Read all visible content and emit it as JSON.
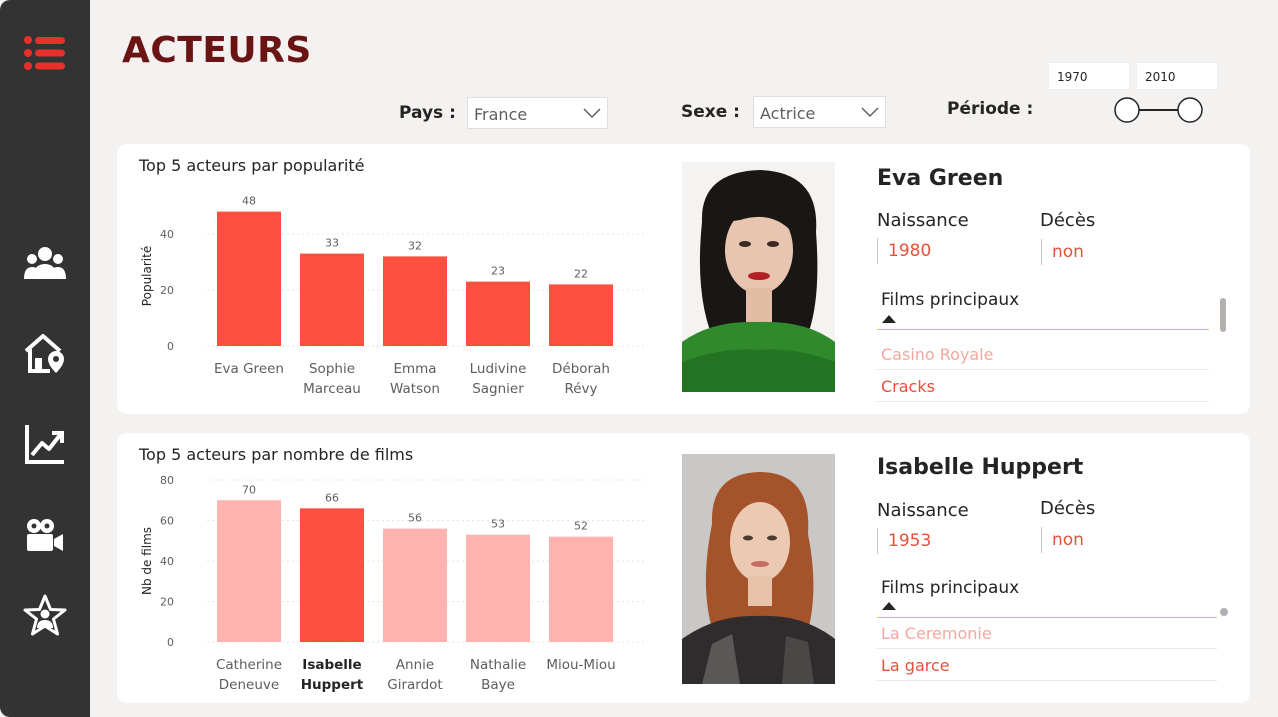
{
  "page": {
    "title": "ACTEURS"
  },
  "filters": {
    "pays_label": "Pays :",
    "pays_value": "France",
    "sexe_label": "Sexe :",
    "sexe_value": "Actrice",
    "periode_label": "Période :",
    "periode_start": "1970",
    "periode_end": "2010"
  },
  "sidebar": {
    "icons": [
      "menu-icon",
      "users-icon",
      "home-location-icon",
      "trend-chart-icon",
      "movie-camera-icon",
      "star-person-icon"
    ]
  },
  "colors": {
    "accent": "#ff4f41",
    "accent_light": "#ffb3ae",
    "title": "#6b1414",
    "sidebar": "#333333",
    "value_text": "#e8503a"
  },
  "chart_data": [
    {
      "type": "bar",
      "title": "Top 5 acteurs par popularité",
      "xlabel": "",
      "ylabel": "Popularité",
      "ylim": [
        0,
        50
      ],
      "yticks": [
        0,
        20,
        40
      ],
      "categories": [
        "Eva Green",
        "Sophie Marceau",
        "Emma Watson",
        "Ludivine Sagnier",
        "Déborah Révy"
      ],
      "category_lines": [
        [
          "Eva Green"
        ],
        [
          "Sophie",
          "Marceau"
        ],
        [
          "Emma",
          "Watson"
        ],
        [
          "Ludivine",
          "Sagnier"
        ],
        [
          "Déborah",
          "Révy"
        ]
      ],
      "values": [
        48,
        33,
        32,
        23,
        22
      ],
      "highlight": [
        true,
        true,
        true,
        true,
        true
      ],
      "grid": true
    },
    {
      "type": "bar",
      "title": "Top 5 acteurs par nombre de films",
      "xlabel": "",
      "ylabel": "Nb de films",
      "ylim": [
        0,
        80
      ],
      "yticks": [
        0,
        20,
        40,
        60,
        80
      ],
      "categories": [
        "Catherine Deneuve",
        "Isabelle Huppert",
        "Annie Girardot",
        "Nathalie Baye",
        "Miou-Miou"
      ],
      "category_lines": [
        [
          "Catherine",
          "Deneuve"
        ],
        [
          "Isabelle",
          "Huppert"
        ],
        [
          "Annie",
          "Girardot"
        ],
        [
          "Nathalie",
          "Baye"
        ],
        [
          "Miou-Miou"
        ]
      ],
      "values": [
        70,
        66,
        56,
        53,
        52
      ],
      "highlight": [
        false,
        true,
        false,
        false,
        false
      ],
      "grid": true
    }
  ],
  "actor1": {
    "name": "Eva Green",
    "naissance_label": "Naissance",
    "naissance": "1980",
    "deces_label": "Décès",
    "deces": "non",
    "films_label": "Films principaux",
    "films": [
      "Casino Royale",
      "Cracks"
    ]
  },
  "actor2": {
    "name": "Isabelle Huppert",
    "naissance_label": "Naissance",
    "naissance": "1953",
    "deces_label": "Décès",
    "deces": "non",
    "films_label": "Films principaux",
    "films": [
      "La Ceremonie",
      "La garce"
    ]
  }
}
